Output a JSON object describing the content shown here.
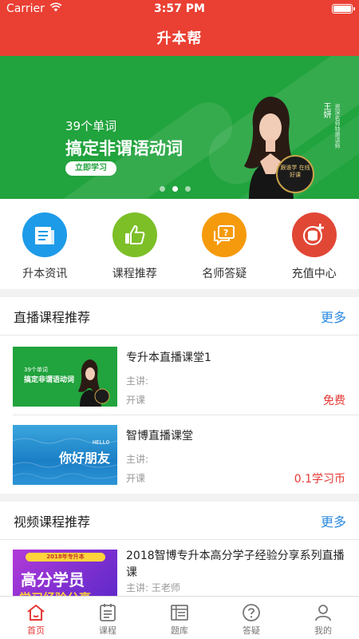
{
  "status_bar": {
    "carrier": "Carrier",
    "time": "3:57 PM"
  },
  "nav": {
    "title": "升本帮"
  },
  "banner": {
    "subtitle": "39个单词",
    "headline": "搞定非谓语动词",
    "button": "立即学习",
    "teacher_name": "王妍",
    "teacher_desc": "资深名师特邀讲师",
    "seal_text": "跟谁学 在线好课",
    "dots_active": 2,
    "dots_total": 3
  },
  "quick_menu": [
    {
      "label": "升本资讯",
      "icon": "news-icon",
      "color": "#1e9be8"
    },
    {
      "label": "课程推荐",
      "icon": "thumbs-up-icon",
      "color": "#7cbf27"
    },
    {
      "label": "名师答疑",
      "icon": "chat-question-icon",
      "color": "#f59a0c"
    },
    {
      "label": "充值中心",
      "icon": "coins-plus-icon",
      "color": "#e14735"
    }
  ],
  "live_section": {
    "title": "直播课程推荐",
    "more": "更多",
    "courses": [
      {
        "title": "专升本直播课堂1",
        "speaker": "主讲:",
        "status": "开课",
        "price": "免费",
        "thumb_sub": "39个单词",
        "thumb_head": "搞定非谓语动词"
      },
      {
        "title": "智博直播课堂",
        "speaker": "主讲:",
        "status": "开课",
        "price": "0.1学习币",
        "thumb_text": "你好朋友",
        "thumb_hello": "HELLO"
      }
    ]
  },
  "video_section": {
    "title": "视频课程推荐",
    "more": "更多",
    "courses": [
      {
        "title": "2018智博专升本高分学子经验分享系列直播课",
        "speaker": "主讲:  王老师",
        "thumb_banner": "2018年专升本",
        "thumb_line1": "高分学员",
        "thumb_line2": "学习经验分享"
      }
    ]
  },
  "tabbar": [
    {
      "label": "首页",
      "icon": "home-icon",
      "active": true
    },
    {
      "label": "课程",
      "icon": "course-list-icon",
      "active": false
    },
    {
      "label": "题库",
      "icon": "question-bank-icon",
      "active": false
    },
    {
      "label": "答疑",
      "icon": "question-circle-icon",
      "active": false
    },
    {
      "label": "我的",
      "icon": "person-icon",
      "active": false
    }
  ],
  "colors": {
    "brand_red": "#ea3f33",
    "banner_green": "#21a33d",
    "link_blue": "#2b8ae0",
    "price_red": "#e53935"
  }
}
